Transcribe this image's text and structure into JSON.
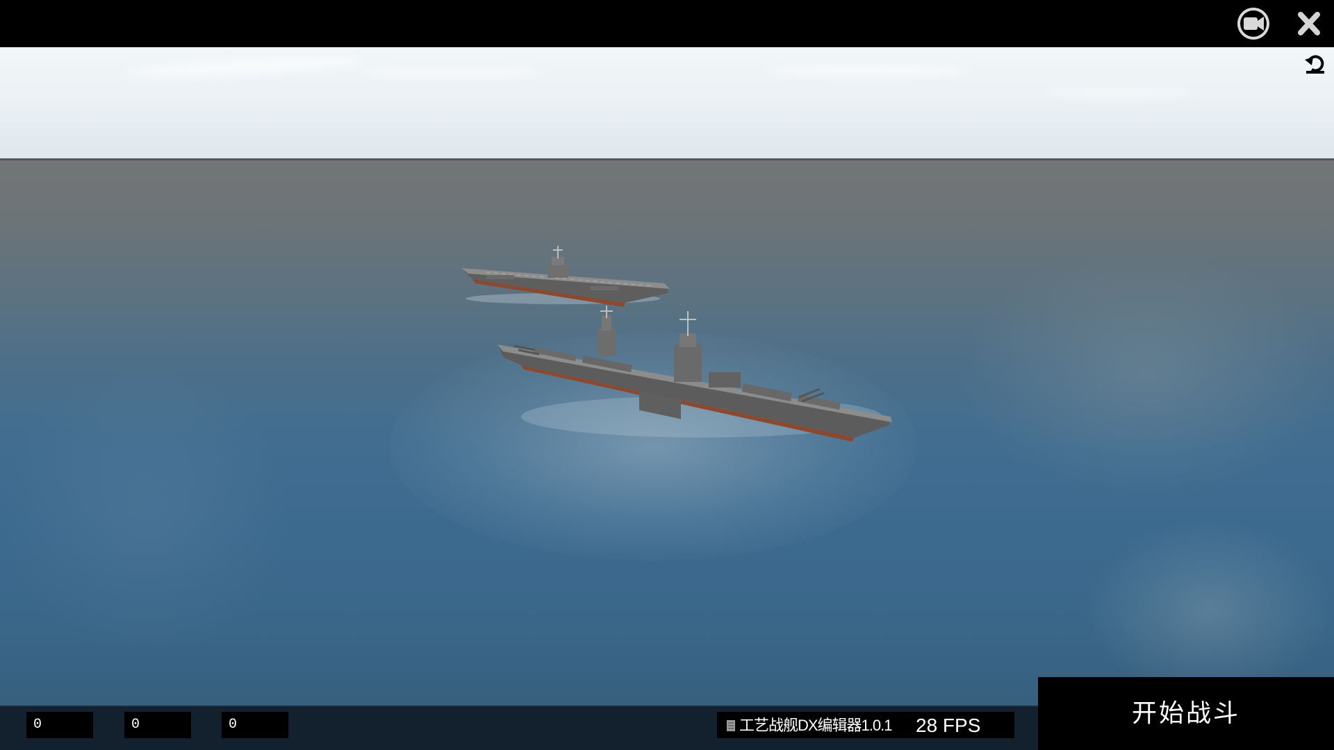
{
  "window": {
    "camera_icon": "camera-icon",
    "close_icon": "close-icon",
    "reset_view_icon": "reset-view-icon"
  },
  "scene": {
    "ships": [
      "aircraft-carrier",
      "battleship"
    ],
    "colors": {
      "sky": "#eef3f6",
      "sea_far": "#747574",
      "sea_near": "#3c6a8f",
      "hull": "#6b6b6b",
      "deck": "#8a8a8a",
      "waterline": "#8a4a32"
    }
  },
  "hud": {
    "counters": [
      "0",
      "0",
      "0"
    ],
    "version": "工艺战舰DX编辑器1.0.1",
    "version_icon": "document-icon",
    "fps": "28 FPS",
    "start_battle": "开始战斗"
  }
}
